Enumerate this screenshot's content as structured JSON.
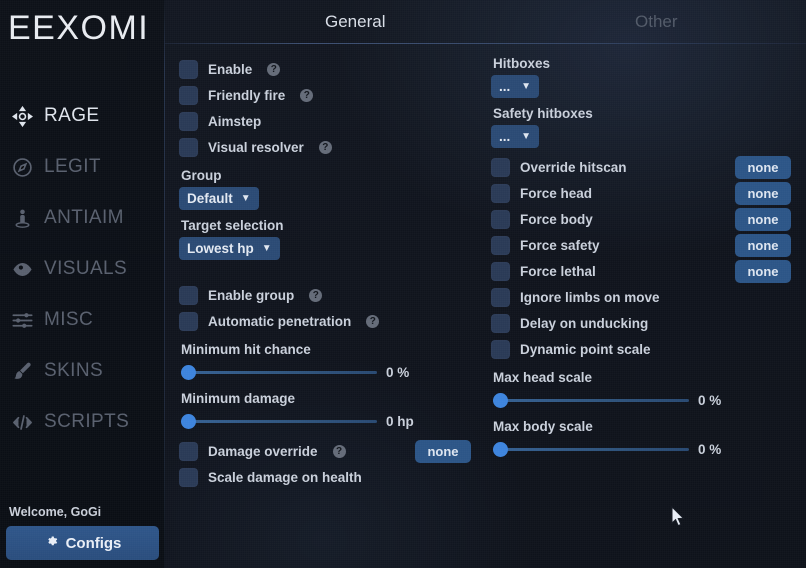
{
  "app": {
    "brand": "EEXOMI"
  },
  "sidebar": {
    "items": [
      {
        "label": "RAGE",
        "icon": "crosshair-icon",
        "active": true
      },
      {
        "label": "LEGIT",
        "icon": "compass-icon",
        "active": false
      },
      {
        "label": "ANTIAIM",
        "icon": "person-icon",
        "active": false
      },
      {
        "label": "VISUALS",
        "icon": "eye-icon",
        "active": false
      },
      {
        "label": "MISC",
        "icon": "sliders-icon",
        "active": false
      },
      {
        "label": "SKINS",
        "icon": "brush-icon",
        "active": false
      },
      {
        "label": "SCRIPTS",
        "icon": "code-icon",
        "active": false
      }
    ],
    "welcome": "Welcome, GoGi",
    "configs_label": "Configs",
    "configs_icon": "gear-icon"
  },
  "tabs": [
    {
      "label": "General",
      "active": true
    },
    {
      "label": "Other",
      "active": false
    }
  ],
  "left_column": {
    "checkboxes_top": [
      {
        "label": "Enable",
        "checked": false,
        "help": true
      },
      {
        "label": "Friendly fire",
        "checked": false,
        "help": true
      },
      {
        "label": "Aimstep",
        "checked": false,
        "help": false
      },
      {
        "label": "Visual resolver",
        "checked": false,
        "help": true
      }
    ],
    "group": {
      "label": "Group",
      "value": "Default"
    },
    "target_selection": {
      "label": "Target selection",
      "value": "Lowest hp"
    },
    "checkboxes_mid": [
      {
        "label": "Enable group",
        "checked": false,
        "help": true
      },
      {
        "label": "Automatic penetration",
        "checked": false,
        "help": true
      }
    ],
    "min_hit_chance": {
      "label": "Minimum hit chance",
      "value": "0 %",
      "percent": 0
    },
    "min_damage": {
      "label": "Minimum damage",
      "value": "0 hp",
      "percent": 0
    },
    "damage_override": {
      "label": "Damage override",
      "checked": false,
      "help": true,
      "button": "none"
    },
    "scale_damage": {
      "label": "Scale damage on health",
      "checked": false,
      "help": false
    }
  },
  "right_column": {
    "hitboxes": {
      "label": "Hitboxes",
      "value": "..."
    },
    "safety_hitboxes": {
      "label": "Safety hitboxes",
      "value": "..."
    },
    "rows": [
      {
        "label": "Override hitscan",
        "checked": false,
        "button": "none"
      },
      {
        "label": "Force head",
        "checked": false,
        "button": "none"
      },
      {
        "label": "Force body",
        "checked": false,
        "button": "none"
      },
      {
        "label": "Force safety",
        "checked": false,
        "button": "none"
      },
      {
        "label": "Force lethal",
        "checked": false,
        "button": "none"
      },
      {
        "label": "Ignore limbs on move",
        "checked": false,
        "button": null
      },
      {
        "label": "Delay on unducking",
        "checked": false,
        "button": null
      },
      {
        "label": "Dynamic point scale",
        "checked": false,
        "button": null
      }
    ],
    "max_head_scale": {
      "label": "Max head scale",
      "value": "0 %",
      "percent": 0
    },
    "max_body_scale": {
      "label": "Max body scale",
      "value": "0 %",
      "percent": 0
    }
  },
  "colors": {
    "accent_blue": "#2c5587",
    "slider_knob": "#3d84dd",
    "checkbox": "#2a3a56",
    "background": "#10141d",
    "text": "#c9d0db",
    "text_dim": "#59606e"
  }
}
